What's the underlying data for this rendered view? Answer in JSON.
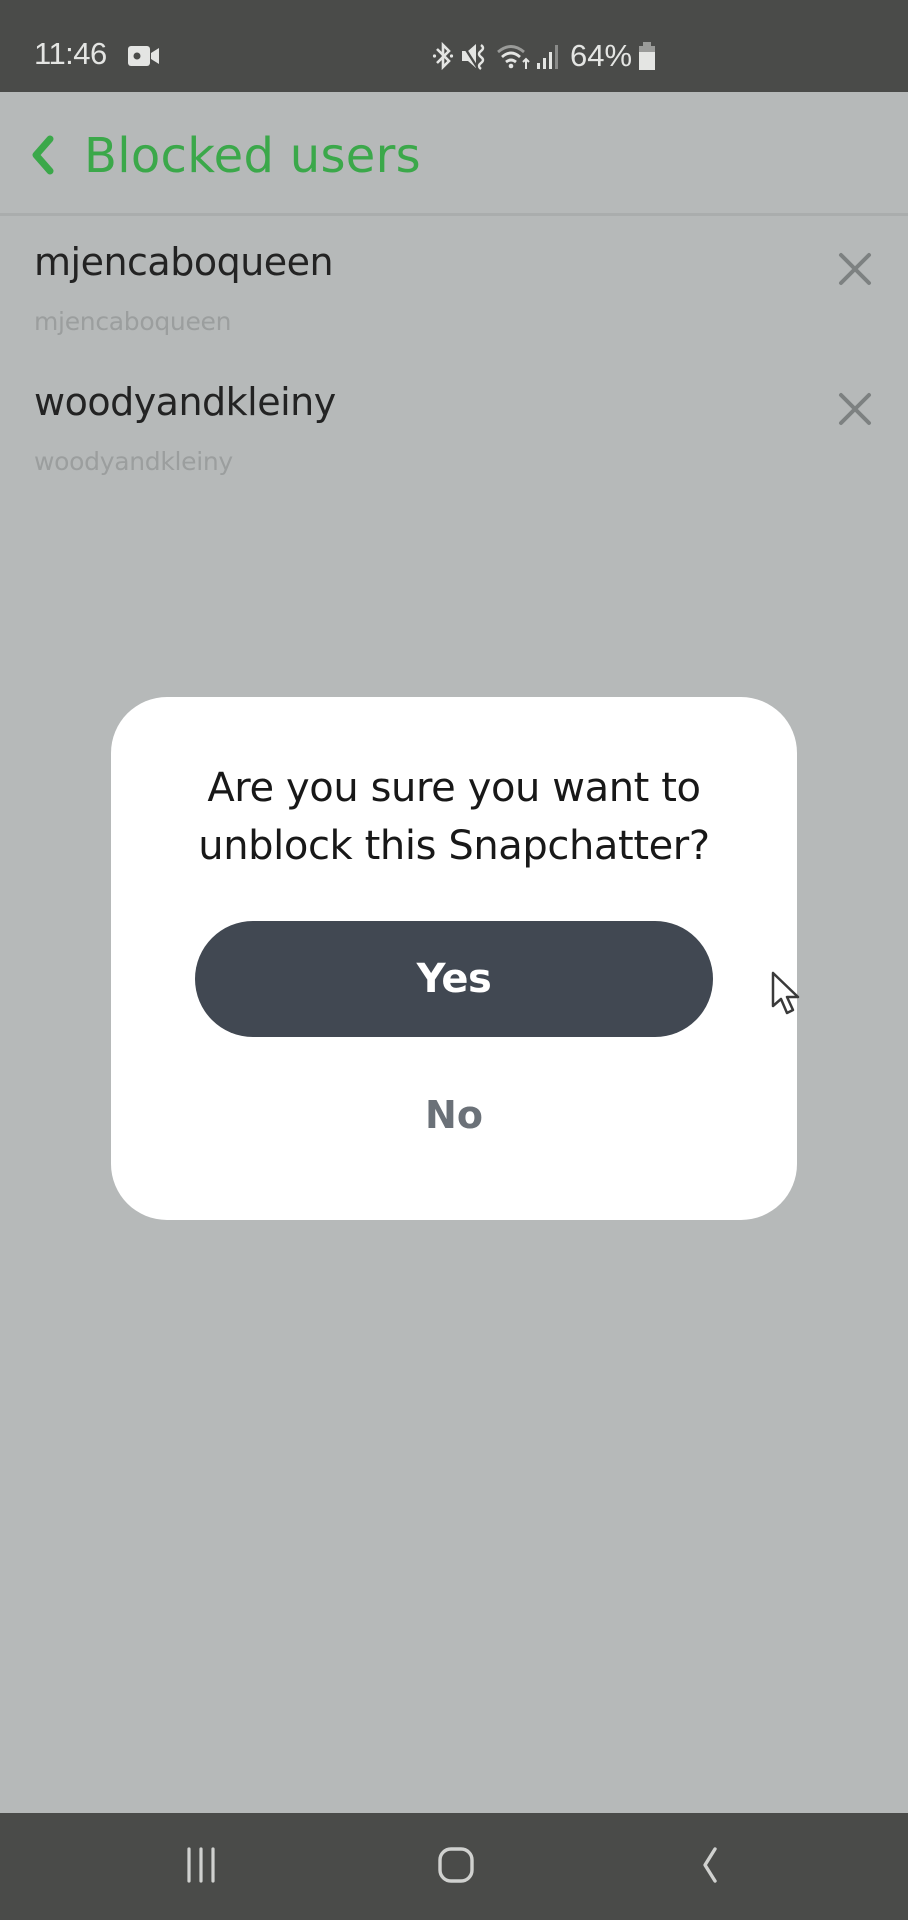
{
  "status_bar": {
    "time": "11:46",
    "battery_percent": "64%",
    "icons": [
      "video-camera-icon",
      "bluetooth-icon",
      "vibrate-icon",
      "wifi-icon",
      "signal-icon",
      "battery-icon"
    ]
  },
  "header": {
    "back_icon": "chevron-left-icon",
    "title": "Blocked users",
    "accent_color": "#3ba84a"
  },
  "blocked_users": [
    {
      "display_name": "mjencaboqueen",
      "username": "mjencaboqueen",
      "action_icon": "close-icon"
    },
    {
      "display_name": "woodyandkleiny",
      "username": "woodyandkleiny",
      "action_icon": "close-icon"
    }
  ],
  "dialog": {
    "message": "Are you sure you want to unblock this Snapchatter?",
    "confirm_label": "Yes",
    "cancel_label": "No",
    "confirm_color": "#414852"
  },
  "nav_bar": {
    "buttons": [
      "recent-apps-icon",
      "home-icon",
      "back-icon"
    ]
  }
}
